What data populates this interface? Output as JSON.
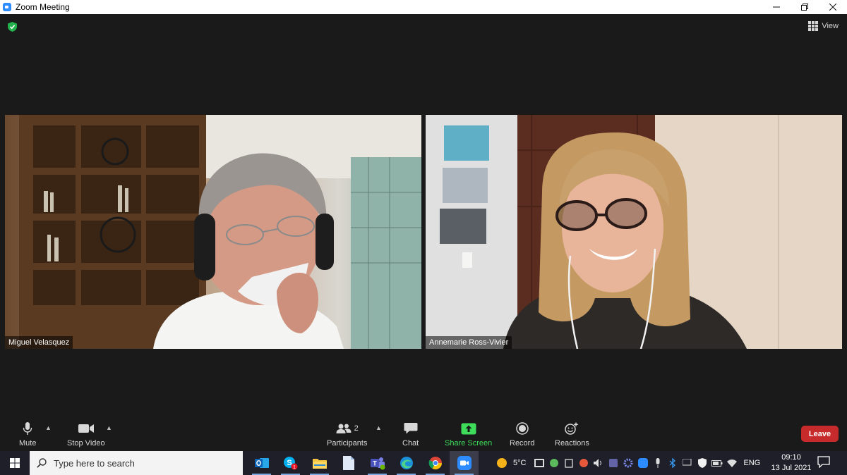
{
  "window": {
    "title": "Zoom Meeting"
  },
  "header": {
    "view_label": "View"
  },
  "participants": [
    {
      "name": "Miguel Velasquez"
    },
    {
      "name": "Annemarie Ross-Vivier"
    }
  ],
  "toolbar": {
    "mute": "Mute",
    "stop_video": "Stop Video",
    "participants": "Participants",
    "participants_count": "2",
    "chat": "Chat",
    "share_screen": "Share Screen",
    "record": "Record",
    "reactions": "Reactions",
    "leave": "Leave"
  },
  "taskbar": {
    "search_placeholder": "Type here to search",
    "apps": [
      "outlook-icon",
      "skype-icon",
      "file-explorer-icon",
      "notepad-icon",
      "teams-icon",
      "edge-icon",
      "chrome-icon",
      "zoom-icon"
    ],
    "skype_badge": "1",
    "temperature": "5°C",
    "language": "ENG",
    "time": "09:10",
    "date": "13 Jul 2021"
  },
  "colors": {
    "share_green": "#3ddc5a",
    "leave_red": "#c72a2a",
    "meeting_bg": "#1a1a1a",
    "taskbar_bg": "#1e1f29"
  }
}
